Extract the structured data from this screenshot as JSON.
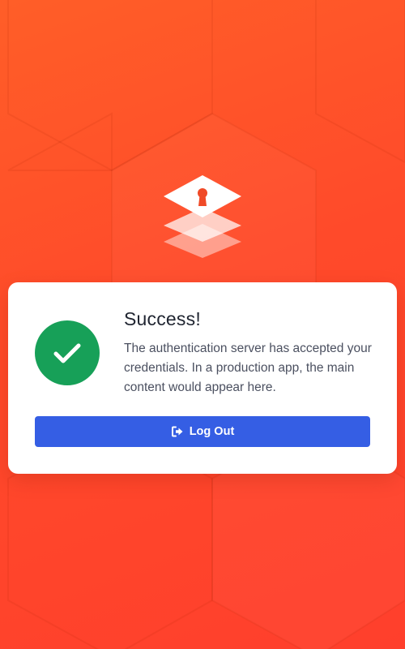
{
  "background": {
    "color_start": "#ff5e28",
    "color_end": "#ff3f2c"
  },
  "logo": {
    "icon": "stacked-layers-keyhole-icon"
  },
  "card": {
    "status_icon": "check-icon",
    "status_color": "#17a058",
    "title": "Success!",
    "message": "The authentication server has accepted your credentials. In a production app, the main content would appear here.",
    "button": {
      "label": "Log Out",
      "icon": "sign-out-icon",
      "color": "#355ee4"
    }
  }
}
